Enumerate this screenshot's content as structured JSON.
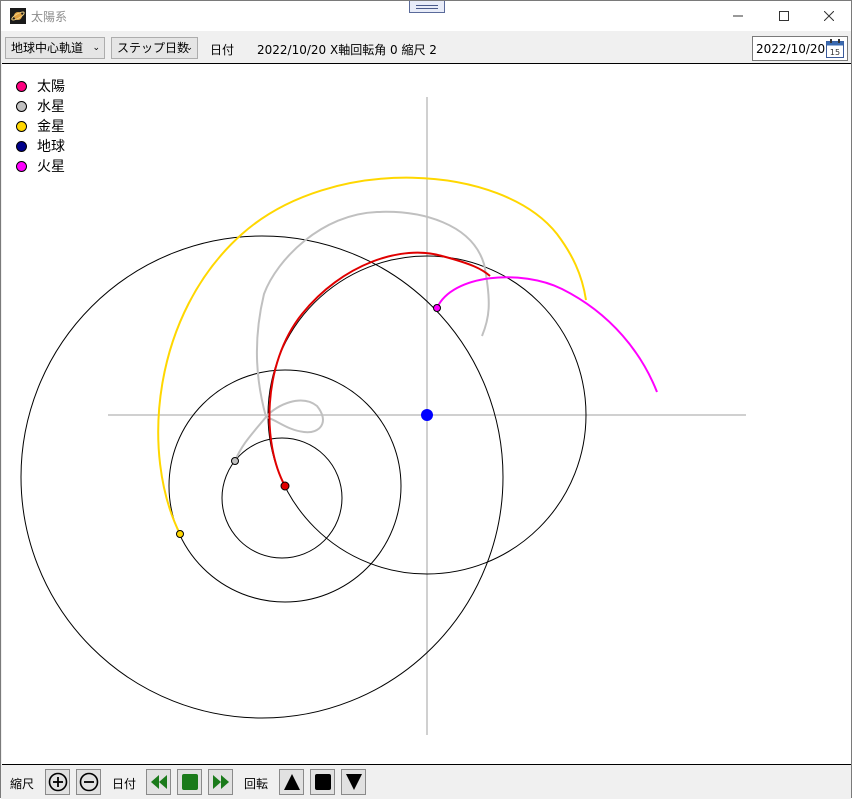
{
  "window": {
    "title": "太陽系"
  },
  "toolbar": {
    "view_mode": "地球中心軌道",
    "step_unit": "ステップ日数",
    "date_label": "日付",
    "status": "2022/10/20 X軸回転角 0  縮尺 2",
    "date_value": "2022/10/20",
    "calendar_day": "15"
  },
  "legend": [
    {
      "label": "太陽",
      "color": "#ff0080"
    },
    {
      "label": "水星",
      "color": "#c0c0c0"
    },
    {
      "label": "金星",
      "color": "#ffd700"
    },
    {
      "label": "地球",
      "color": "#00008b"
    },
    {
      "label": "火星",
      "color": "#ff00ff"
    }
  ],
  "bottom": {
    "scale_label": "縮尺",
    "date_label": "日付",
    "rotate_label": "回転"
  },
  "colors": {
    "sun_path": "#e00000",
    "mercury_path": "#c0c0c0",
    "venus_path": "#ffd700",
    "mars_path": "#ff00ff",
    "earth_center": "#0000ff",
    "play_green": "#1a7a1a"
  },
  "icons": {
    "app": "saturn-icon",
    "minimize": "minimize-icon",
    "maximize": "maximize-icon",
    "close": "close-icon",
    "calendar": "calendar-icon"
  }
}
